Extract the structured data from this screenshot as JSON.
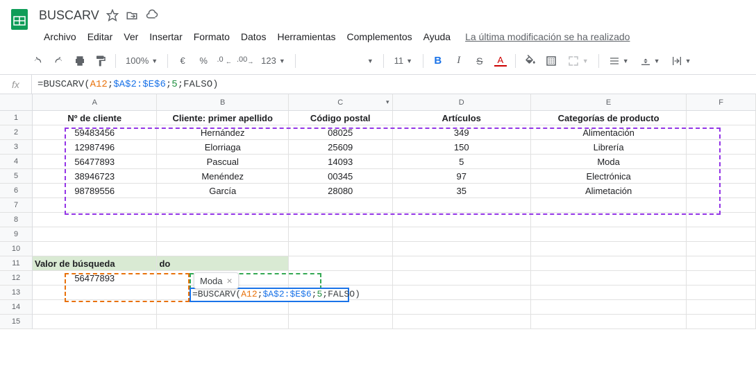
{
  "doc": {
    "title": "BUSCARV"
  },
  "menu": {
    "items": [
      "Archivo",
      "Editar",
      "Ver",
      "Insertar",
      "Formato",
      "Datos",
      "Herramientas",
      "Complementos",
      "Ayuda"
    ],
    "last_edit": "La última modificación se ha realizado"
  },
  "toolbar": {
    "zoom": "100%",
    "currency": "€",
    "percent": "%",
    "dec_less": ".0",
    "dec_more": ".00",
    "num_fmt": "123",
    "font_size": "11"
  },
  "formula_bar": {
    "prefix": "=BUSCARV(",
    "arg1": "A12",
    "sep1": ";",
    "arg2": "$A$2:$E$6",
    "sep2": ";",
    "arg3": "5",
    "sep3": ";",
    "arg4": "FALSO",
    "suffix": ")"
  },
  "columns": [
    "A",
    "B",
    "C",
    "D",
    "E",
    "F"
  ],
  "sheet": {
    "headers_row1": [
      "Nº de cliente",
      "Cliente: primer apellido",
      "Código postal",
      "Artículos",
      "Categorías de producto"
    ],
    "data": [
      [
        "59483456",
        "Hernández",
        "08025",
        "349",
        "Alimentación"
      ],
      [
        "12987496",
        "Elorriaga",
        "25609",
        "150",
        "Librería"
      ],
      [
        "56477893",
        "Pascual",
        "14093",
        "5",
        "Moda"
      ],
      [
        "38946723",
        "Menéndez",
        "00345",
        "97",
        "Electrónica"
      ],
      [
        "98789556",
        "García",
        "28080",
        "35",
        "Alimetación"
      ]
    ],
    "search_header": [
      "Valor de búsqueda",
      "do"
    ],
    "search_value": "56477893",
    "tooltip": "Moda"
  },
  "row_nums": [
    "1",
    "2",
    "3",
    "4",
    "5",
    "6",
    "7",
    "8",
    "9",
    "10",
    "11",
    "12",
    "13",
    "14",
    "15"
  ]
}
